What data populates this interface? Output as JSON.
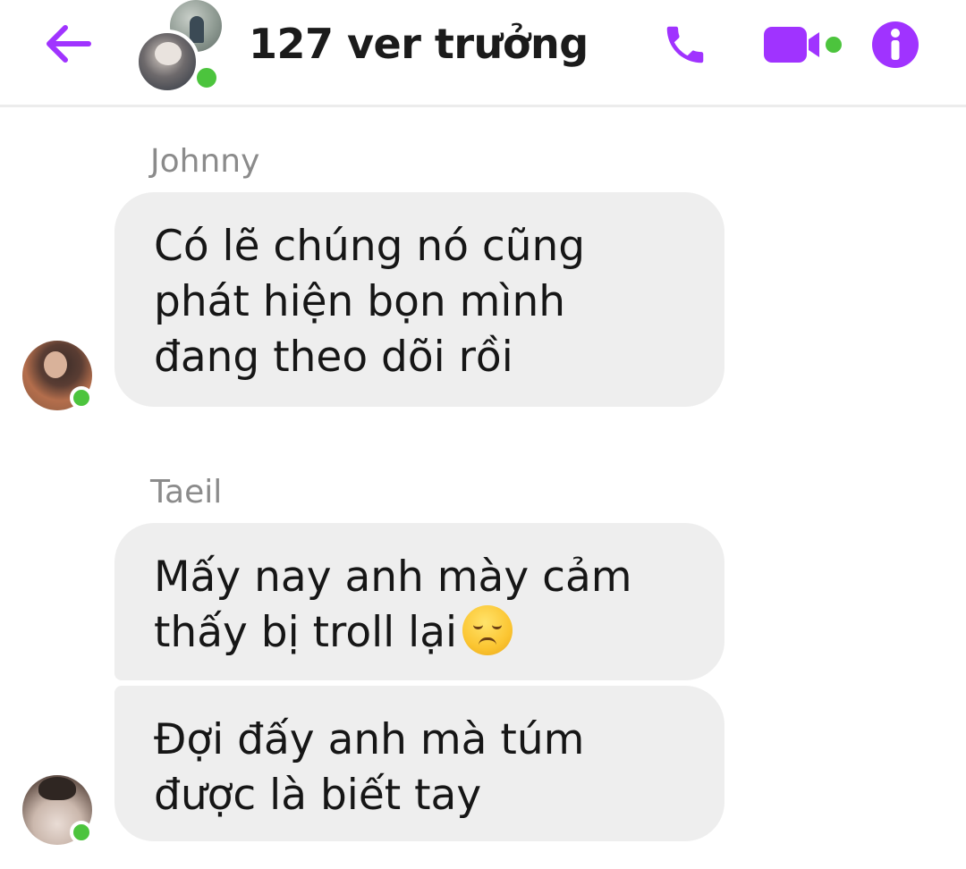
{
  "header": {
    "title": "127 ver trưởng",
    "back_icon": "arrow-left-icon",
    "call_icon": "phone-icon",
    "video_icon": "video-camera-icon",
    "info_icon": "info-icon",
    "accent_color": "#a033ff",
    "online_color": "#4cc43d"
  },
  "messages": [
    {
      "sender": "Johnny",
      "bubbles": [
        {
          "lines": [
            "Có lẽ chúng nó cũng",
            "phát hiện bọn mình",
            "đang theo dõi rồi"
          ]
        }
      ]
    },
    {
      "sender": "Taeil",
      "bubbles": [
        {
          "lines": [
            "Mấy nay anh mày cảm",
            "thấy bị troll lại"
          ],
          "emoji": "disappointed-face-emoji"
        },
        {
          "lines": [
            "Đợi đấy anh mà túm",
            "được là biết tay"
          ]
        }
      ]
    }
  ],
  "bubble_color": "#eeeeee"
}
